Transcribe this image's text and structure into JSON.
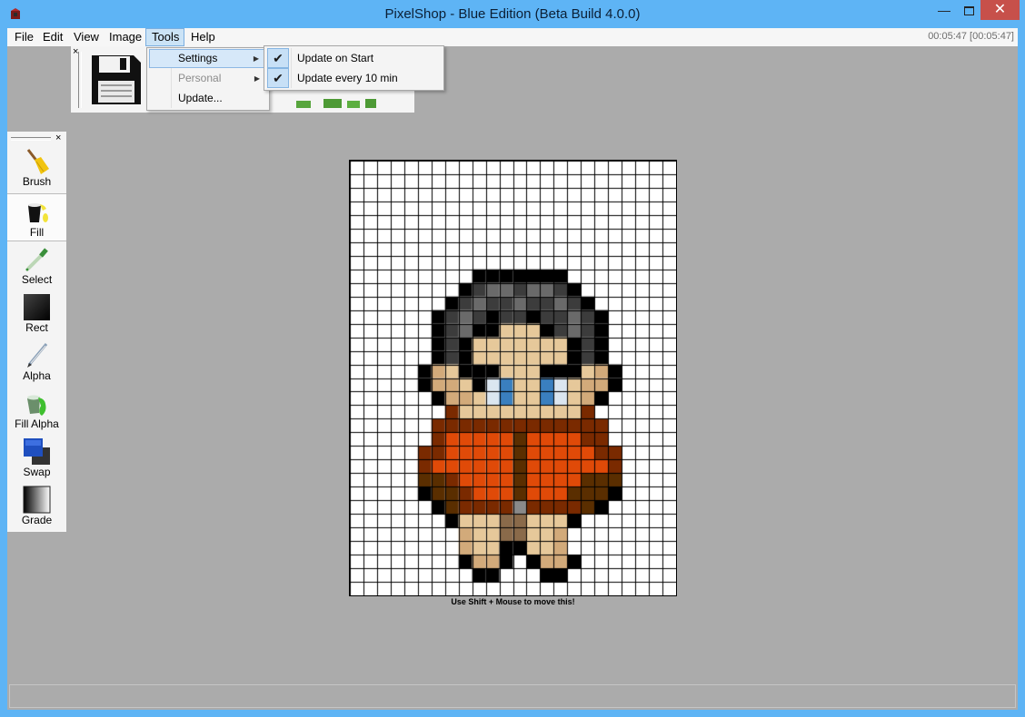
{
  "window": {
    "title": "PixelShop - Blue Edition (Beta Build 4.0.0)",
    "minimize": "—",
    "close": "✕"
  },
  "menu": {
    "items": [
      "File",
      "Edit",
      "View",
      "Image",
      "Tools",
      "Help"
    ],
    "active": "Tools",
    "timer": "00:05:47 [00:05:47]"
  },
  "tools_menu": {
    "items": [
      {
        "label": "Settings",
        "submenu": true,
        "highlighted": true,
        "enabled": true
      },
      {
        "label": "Personal",
        "submenu": true,
        "highlighted": false,
        "enabled": false
      },
      {
        "label": "Update...",
        "submenu": false,
        "highlighted": false,
        "enabled": true
      }
    ]
  },
  "settings_submenu": {
    "items": [
      {
        "label": "Update on Start",
        "checked": true
      },
      {
        "label": "Update every 10 min",
        "checked": true
      }
    ]
  },
  "toolbar": {
    "close": "×",
    "save_icon": "floppy-disk-icon"
  },
  "tool_panel": {
    "close": "×",
    "selected": "Fill",
    "tools": [
      {
        "label": "Brush",
        "icon": "broom-icon"
      },
      {
        "label": "Fill",
        "icon": "paint-bucket-icon"
      },
      {
        "label": "Select",
        "icon": "eyedropper-icon"
      },
      {
        "label": "Rect",
        "icon": "rectangle-icon"
      },
      {
        "label": "Alpha",
        "icon": "pencil-icon"
      },
      {
        "label": "Fill Alpha",
        "icon": "green-bucket-icon"
      },
      {
        "label": "Swap",
        "icon": "swap-colors-icon"
      },
      {
        "label": "Grade",
        "icon": "gradient-icon"
      }
    ]
  },
  "canvas": {
    "grid_cols": 24,
    "grid_rows": 32,
    "grid_line_color": "#000000",
    "hint": "Use Shift + Mouse to move this!"
  },
  "colors": {
    "title_bar": "#5eb4f5",
    "workspace": "#ababab",
    "panel": "#f4f4f4",
    "close_button": "#c7504a",
    "menu_highlight": "#cbe3f6"
  }
}
